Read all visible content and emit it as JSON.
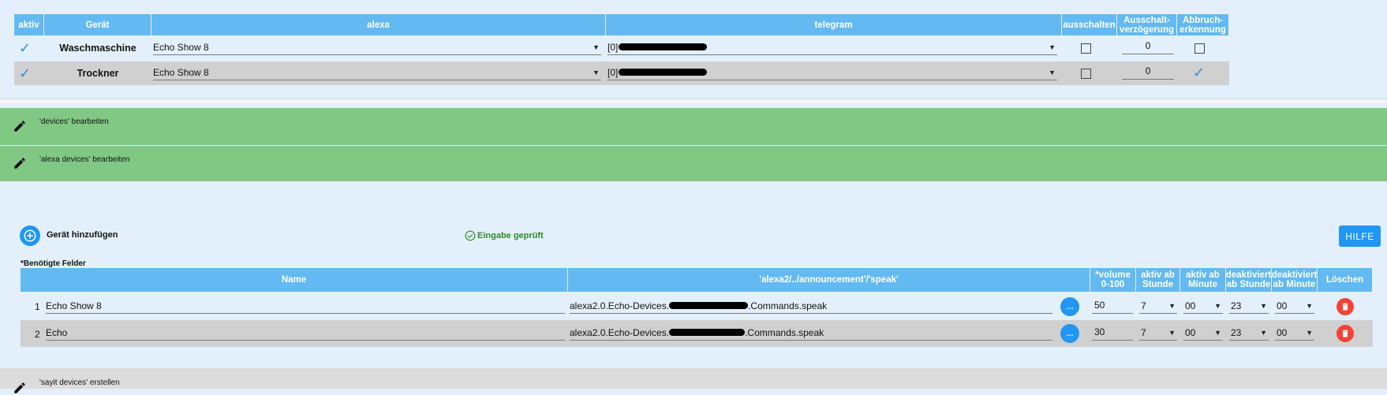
{
  "top_table": {
    "headers": {
      "aktiv": "aktiv",
      "geraet": "Gerät",
      "alexa": "alexa",
      "telegram": "telegram",
      "ausschalten": "ausschalten",
      "verzoegerung": "Ausschalt-verzögerung",
      "abbruch": "Abbruch-erkennung"
    },
    "rows": [
      {
        "device": "Waschmaschine",
        "alexa": "Echo Show 8",
        "telegram_prefix": "[0]",
        "delay": "0",
        "aktiv": true,
        "ausschalten": false,
        "abbruch": false
      },
      {
        "device": "Trockner",
        "alexa": "Echo Show 8",
        "telegram_prefix": "[0]",
        "delay": "0",
        "aktiv": true,
        "ausschalten": false,
        "abbruch": true
      }
    ]
  },
  "sections": {
    "devices_label": "'devices' bearbeiten",
    "alexa_devices_label": "'alexa devices' bearbeiten",
    "sayit_label": "'sayit devices' erstellen"
  },
  "alexa_panel": {
    "add_device_label": "Gerät hinzufügen",
    "validated_label": "Eingabe geprüft",
    "help_label": "HILFE",
    "required_note": "*Benötigte Felder",
    "headers": {
      "name": "Name",
      "announce": "'alexa2/../announcement'/'speak'",
      "volume": "*volume 0-100",
      "aktiv_stunde": "aktiv ab Stunde",
      "aktiv_minute": "aktiv ab Minute",
      "deakt_stunde": "deaktiviert ab Stunde",
      "deakt_minute": "deaktiviert ab Minute",
      "loeschen": "Löschen"
    },
    "rows": [
      {
        "index": "1",
        "name": "Echo Show 8",
        "path_prefix": "alexa2.0.Echo-Devices.",
        "path_suffix": ".Commands.speak",
        "volume": "50",
        "aktiv_stunde": "7",
        "aktiv_minute": "00",
        "deakt_stunde": "23",
        "deakt_minute": "00"
      },
      {
        "index": "2",
        "name": "Echo",
        "path_prefix": "alexa2.0.Echo-Devices.",
        "path_suffix": ".Commands.speak",
        "volume": "30",
        "aktiv_stunde": "7",
        "aktiv_minute": "00",
        "deakt_stunde": "23",
        "deakt_minute": "00"
      }
    ]
  },
  "icons": {
    "check": "check-icon",
    "pencil": "pencil-icon",
    "add": "add-circle-icon",
    "validated": "check-circle-icon",
    "more": "more-icon",
    "delete": "trash-icon",
    "caret": "caret-down-icon"
  },
  "colors": {
    "header_blue": "#63b9f1",
    "section_green": "#82c885",
    "accent_blue": "#2196f3",
    "delete_red": "#f44336",
    "validated_green": "#2e8b2e"
  }
}
